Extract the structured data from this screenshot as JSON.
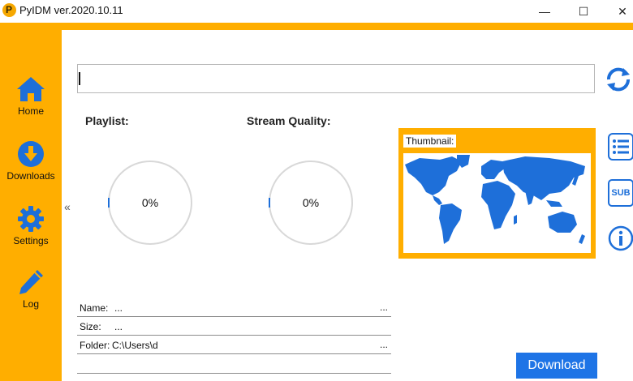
{
  "window": {
    "title": "PyIDM ver.2020.10.11",
    "controls": {
      "minimize": "—",
      "maximize": "☐",
      "close": "✕"
    }
  },
  "sidebar": {
    "items": [
      {
        "label": "Home",
        "icon": "home-icon"
      },
      {
        "label": "Downloads",
        "icon": "download-icon"
      },
      {
        "label": "Settings",
        "icon": "gear-icon"
      },
      {
        "label": "Log",
        "icon": "pencil-icon"
      }
    ],
    "collapse_symbol": "«"
  },
  "main": {
    "url_input": {
      "value": "",
      "placeholder": ""
    },
    "playlist_label": "Playlist:",
    "stream_quality_label": "Stream Quality:",
    "playlist_progress": "0%",
    "stream_progress": "0%",
    "thumbnail_label": "Thumbnail:",
    "side_buttons": {
      "subtitles": "SUB"
    },
    "info": {
      "name_label": "Name:",
      "name_value": "...",
      "name_more": "...",
      "size_label": "Size:",
      "size_value": "...",
      "folder_label": "Folder:",
      "folder_value": "C:\\Users\\d",
      "folder_more": "..."
    },
    "download_button": "Download"
  },
  "colors": {
    "accent_orange": "#ffae00",
    "accent_blue": "#1e74e6"
  }
}
